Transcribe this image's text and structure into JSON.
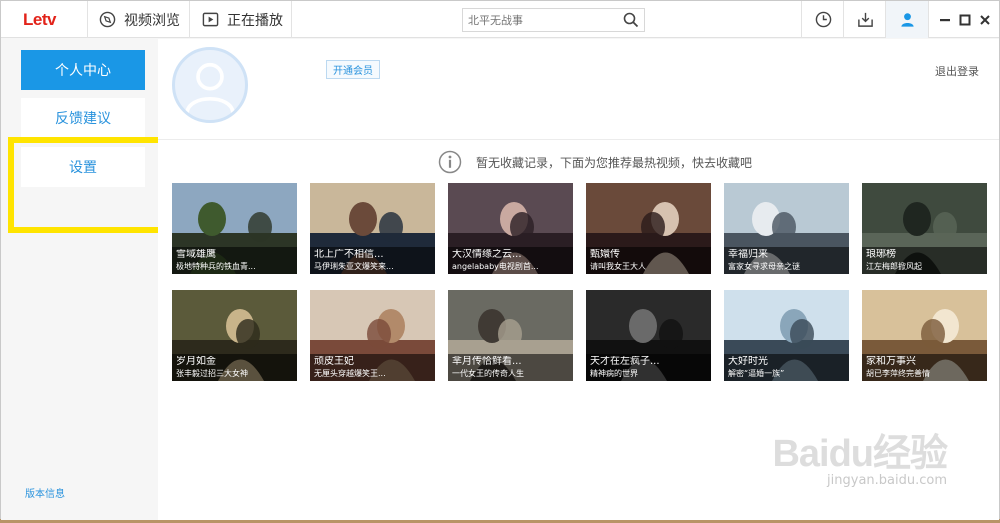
{
  "app": {
    "logo": "Letv"
  },
  "nav": {
    "browse": "视频浏览",
    "playing": "正在播放"
  },
  "search": {
    "placeholder": "北平无战事"
  },
  "toolbar": {
    "icons": [
      "clock-icon",
      "download-icon",
      "user-icon"
    ]
  },
  "window": {
    "icons": [
      "minimize-icon",
      "maximize-icon",
      "close-icon"
    ]
  },
  "sidebar": {
    "items": [
      {
        "label": "个人中心",
        "active": true
      },
      {
        "label": "反馈建议",
        "active": false
      },
      {
        "label": "设置",
        "active": false
      }
    ],
    "version": "版本信息"
  },
  "profile": {
    "vip_button": "开通会员",
    "logout": "退出登录"
  },
  "notice": "暂无收藏记录，下面为您推荐最热视频，快去收藏吧",
  "videos": [
    {
      "title": "雪域雄鹰",
      "subtitle": "极地特种兵的铁血青..."
    },
    {
      "title": "北上广不相信...",
      "subtitle": "马伊琍朱亚文爆笑来..."
    },
    {
      "title": "大汉情缘之云...",
      "subtitle": "angelababy电视剧首..."
    },
    {
      "title": "甄嬛传",
      "subtitle": "请叫我女王大人"
    },
    {
      "title": "幸福归来",
      "subtitle": "富家女寻求母亲之谜"
    },
    {
      "title": "琅琊榜",
      "subtitle": "江左梅郎掀风起"
    },
    {
      "title": "岁月如金",
      "subtitle": "张丰毅过招三大女神"
    },
    {
      "title": "顽皮王妃",
      "subtitle": "无厘头穿越爆笑王..."
    },
    {
      "title": "芈月传恰鲜看...",
      "subtitle": "一代女王的传奇人生"
    },
    {
      "title": "天才在左疯子...",
      "subtitle": "精神病的世界"
    },
    {
      "title": "大好时光",
      "subtitle": "解密“逼婚一族”"
    },
    {
      "title": "家和万事兴",
      "subtitle": "胡已李萍终完善情"
    }
  ],
  "watermark": {
    "brand": "Baidu经验",
    "url": "jingyan.baidu.com"
  },
  "colors": {
    "accent": "#1a97e6",
    "highlight": "#ffe400",
    "logo": "#e2231a"
  }
}
